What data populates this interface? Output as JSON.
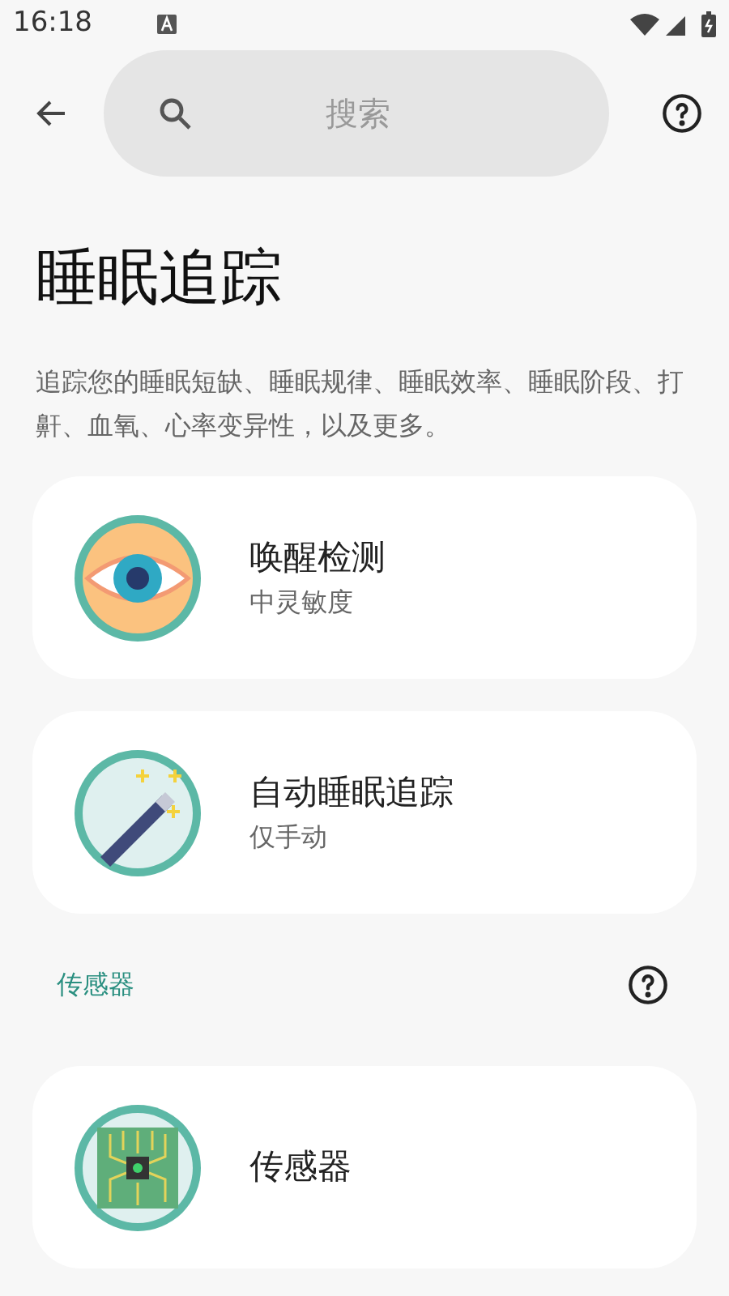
{
  "status_bar": {
    "time": "16:18"
  },
  "search": {
    "placeholder": "搜索"
  },
  "page": {
    "title": "睡眠追踪",
    "description": "追踪您的睡眠短缺、睡眠规律、睡眠效率、睡眠阶段、打鼾、血氧、心率变异性，以及更多。"
  },
  "items": [
    {
      "kind": "eye",
      "title": "唤醒检测",
      "subtitle": "中灵敏度"
    },
    {
      "kind": "wand",
      "title": "自动睡眠追踪",
      "subtitle": "仅手动"
    }
  ],
  "section": {
    "title": "传感器"
  },
  "section_items": [
    {
      "kind": "chip",
      "title": "传感器"
    }
  ]
}
